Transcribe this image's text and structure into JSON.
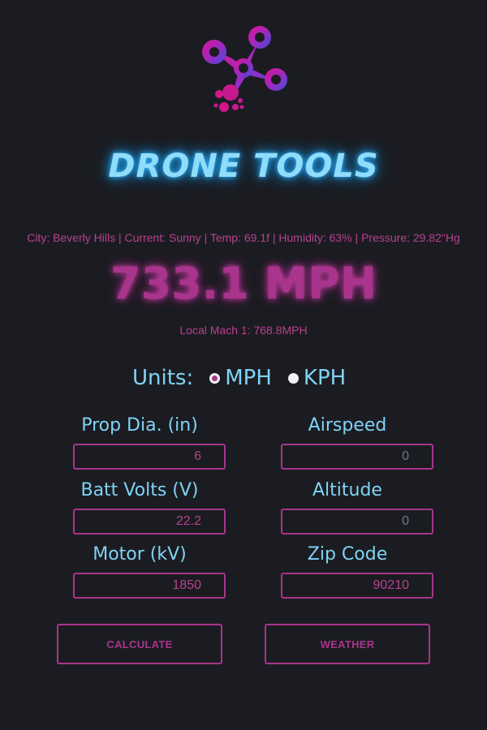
{
  "app": {
    "title": "DRONE TOOLS"
  },
  "weather": {
    "line": "City: Beverly Hills | Current: Sunny | Temp: 69.1f | Humidity: 63% | Pressure: 29.82\"Hg"
  },
  "result": {
    "speed": "733.1 MPH",
    "mach": "Local Mach 1: 768.8MPH"
  },
  "units": {
    "label": "Units:",
    "options": [
      {
        "label": "MPH",
        "selected": true
      },
      {
        "label": "KPH",
        "selected": false
      }
    ]
  },
  "fields": {
    "prop_dia": {
      "label": "Prop Dia. (in)",
      "value": "6"
    },
    "airspeed": {
      "label": "Airspeed",
      "value": "0"
    },
    "batt_volts": {
      "label": "Batt Volts (V)",
      "value": "22.2"
    },
    "altitude": {
      "label": "Altitude",
      "value": "0"
    },
    "motor_kv": {
      "label": "Motor (kV)",
      "value": "1850"
    },
    "zip_code": {
      "label": "Zip Code",
      "value": "90210"
    }
  },
  "buttons": {
    "calculate": "CALCULATE",
    "weather": "WEATHER"
  },
  "colors": {
    "background": "#1b1c21",
    "accent_pink": "#a8348c",
    "accent_cyan": "#7fd3f5"
  },
  "icons": {
    "logo": "drone-logo-icon"
  }
}
